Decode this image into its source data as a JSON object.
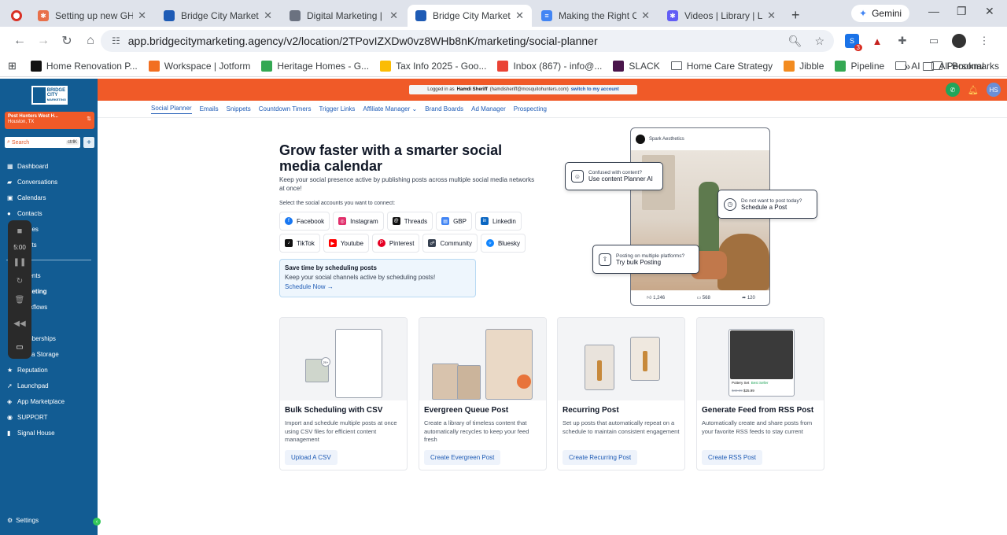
{
  "browser": {
    "tabs": [
      {
        "label": "Setting up new GHL ac",
        "color": "#e8704a"
      },
      {
        "label": "Bridge City Marketing",
        "color": "#1e5bb5"
      },
      {
        "label": "Digital Marketing | Gre",
        "color": "#6b7280"
      },
      {
        "label": "Bridge City Marketing",
        "color": "#1e5bb5"
      },
      {
        "label": "Making the Right Com",
        "color": "#4285f4"
      },
      {
        "label": "Videos | Library | Loom",
        "color": "#625df5"
      }
    ],
    "gemini_label": "Gemini",
    "url": "app.bridgecitymarketing.agency/v2/location/2TPovIZXDw0vz8WHb8nK/marketing/social-planner",
    "extension_badge": "3",
    "bookmarks": [
      {
        "label": "Home Renovation P...",
        "type": "site",
        "color": "#111"
      },
      {
        "label": "Workspace | Jotform",
        "type": "site",
        "color": "#f26f21"
      },
      {
        "label": "Heritage Homes - G...",
        "type": "site",
        "color": "#34a853"
      },
      {
        "label": "Tax Info 2025 - Goo...",
        "type": "site",
        "color": "#fbbc04"
      },
      {
        "label": "Inbox (867) - info@...",
        "type": "site",
        "color": "#ea4335"
      },
      {
        "label": "SLACK",
        "type": "site",
        "color": "#4a154b"
      },
      {
        "label": "Home Care Strategy",
        "type": "folder"
      },
      {
        "label": "Jibble",
        "type": "site",
        "color": "#f28b20"
      },
      {
        "label": "Pipeline",
        "type": "site",
        "color": "#34a853"
      },
      {
        "label": "AI",
        "type": "folder"
      },
      {
        "label": "Personal",
        "type": "folder"
      }
    ],
    "all_bookmarks": "All Bookmarks",
    "more_chevron": "»"
  },
  "sidebar": {
    "logo": {
      "line1": "BRIDGE",
      "line2": "CITY",
      "line3": "MARKETING"
    },
    "location_name": "Pest Hunters West H...",
    "location_city": "Houston, TX",
    "search_placeholder": "Search",
    "search_shortcut": "ctrlK",
    "items": [
      {
        "label": "Dashboard",
        "icon": "dashboard-icon"
      },
      {
        "label": "Conversations",
        "icon": "chat-icon"
      },
      {
        "label": "Calendars",
        "icon": "calendar-icon"
      },
      {
        "label": "Contacts",
        "icon": "contacts-icon"
      },
      {
        "label": "nes",
        "icon": "opportunities-icon"
      },
      {
        "label": "nts",
        "icon": "payments-icon"
      },
      {
        "label": "gents",
        "icon": "agents-icon"
      },
      {
        "label": "keting",
        "icon": "marketing-icon"
      },
      {
        "label": "kflows",
        "icon": "workflows-icon"
      },
      {
        "label": "mberships",
        "icon": "memberships-icon"
      },
      {
        "label": "a Storage",
        "icon": "storage-icon"
      },
      {
        "label": "Reputation",
        "icon": "star-icon"
      },
      {
        "label": "Launchpad",
        "icon": "rocket-icon"
      },
      {
        "label": "App Marketplace",
        "icon": "marketplace-icon"
      },
      {
        "label": "SUPPORT",
        "icon": "support-icon"
      },
      {
        "label": "Signal House",
        "icon": "signal-icon"
      }
    ],
    "settings_label": "Settings"
  },
  "recorder": {
    "time": "5:00"
  },
  "topbar": {
    "logged_in_prefix": "Logged in as",
    "user_name": "Hamdi Sheriff",
    "user_email": "(hamdisheriff@mosquitohunters.com)",
    "switch_label": "switch to my account",
    "avatar_initials": "HS"
  },
  "subnav": [
    "Social Planner",
    "Emails",
    "Snippets",
    "Countdown Timers",
    "Trigger Links",
    "Affiliate Manager",
    "Brand Boards",
    "Ad Manager",
    "Prospecting"
  ],
  "hero": {
    "title": "Grow faster with a smarter social media calendar",
    "description": "Keep your social presence active by publishing posts across multiple social media networks at once!",
    "select_label": "Select the social accounts you want to connect:",
    "accounts_row1": [
      {
        "label": "Facebook",
        "color": "#1877f2"
      },
      {
        "label": "Instagram",
        "color": "#e1306c"
      },
      {
        "label": "Threads",
        "color": "#111111"
      },
      {
        "label": "GBP",
        "color": "#4285f4"
      },
      {
        "label": "Linkedin",
        "color": "#0a66c2"
      }
    ],
    "accounts_row2": [
      {
        "label": "TikTok",
        "color": "#111111"
      },
      {
        "label": "Youtube",
        "color": "#ff0000"
      },
      {
        "label": "Pinterest",
        "color": "#e60023"
      },
      {
        "label": "Community",
        "color": "#374151"
      },
      {
        "label": "Bluesky",
        "color": "#1185fe"
      }
    ],
    "save_box": {
      "title": "Save time by scheduling posts",
      "description": "Keep your social channels active by scheduling posts!",
      "cta": "Schedule Now"
    },
    "phone": {
      "brand": "Spark Aesthetics",
      "likes": "1,246",
      "comments": "568",
      "shares": "120"
    },
    "callouts": [
      {
        "question": "Confused with content?",
        "action": "Use content Planner AI"
      },
      {
        "question": "Do not want to post today?",
        "action": "Schedule a Post"
      },
      {
        "question": "Posting on multiple platforms?",
        "action": "Try bulk Posting"
      }
    ]
  },
  "cards": [
    {
      "title": "Bulk Scheduling with CSV",
      "description": "Import and schedule multiple posts at once using CSV files for efficient content management",
      "button": "Upload A CSV",
      "badge": "20+"
    },
    {
      "title": "Evergreen Queue Post",
      "description": "Create a library of timeless content that automatically recycles to keep your feed fresh",
      "button": "Create Evergreen Post"
    },
    {
      "title": "Recurring Post",
      "description": "Set up posts that automatically repeat on a schedule to maintain consistent engagement",
      "button": "Create Recurring Post"
    },
    {
      "title": "Generate Feed from RSS Post",
      "description": "Automatically create and share posts from your favorite RSS feeds to stay current",
      "button": "Create RSS Post",
      "product_name": "Pottery Set",
      "product_tag": "Best Seller",
      "old_price": "$49.99",
      "new_price": "$25.99"
    }
  ],
  "colors": {
    "sidebar": "#125c93",
    "topbar": "#f05a28",
    "accent": "#1e5bb5"
  }
}
